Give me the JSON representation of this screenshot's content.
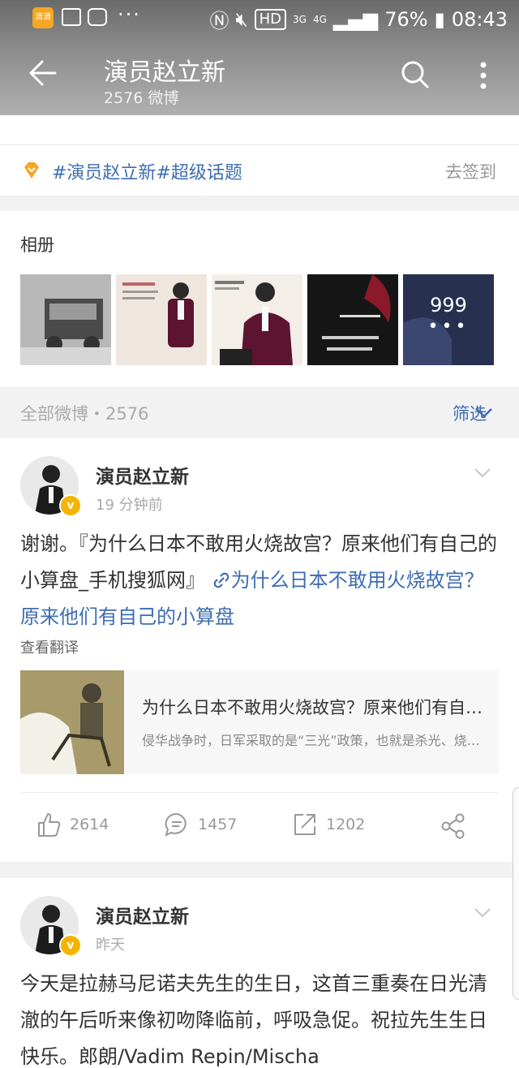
{
  "status_bar": {
    "battery": "76%",
    "time": "08:43",
    "network_a": "3G",
    "network_b": "4G",
    "hd": "HD",
    "app_badge": "滴滴"
  },
  "header": {
    "title": "演员赵立新",
    "subtitle": "2576 微博"
  },
  "topic": {
    "text": "#演员赵立新#超级话题",
    "action": "去签到"
  },
  "album": {
    "title": "相册",
    "more_count": "999"
  },
  "feed_bar": {
    "all": "全部微博・2576",
    "filter": "筛选"
  },
  "posts": [
    {
      "author": "演员赵立新",
      "time": "19 分钟前",
      "text": "谢谢。『为什么日本不敢用火烧故宫？原来他们有自己的小算盘_手机搜狐网』",
      "link": "为什么日本不敢用火烧故宫？原来他们有自己的小算盘",
      "translate": "查看翻译",
      "card": {
        "title": "为什么日本不敢用火烧故宫？原来他们有自己的小算盘",
        "desc": "侵华战争时，日军采取的是“三光”政策，也就是杀光、烧光、抢光"
      },
      "likes": "2614",
      "comments": "1457",
      "reposts": "1202"
    },
    {
      "author": "演员赵立新",
      "time": "昨天",
      "text": "今天是拉赫马尼诺夫先生的生日，这首三重奏在日光清澈的午后听来像初吻降临前，呼吸急促。祝拉先生生日快乐。郎朗/Vadim Repin/Mischa"
    }
  ],
  "colors": {
    "link": "#3d6db2",
    "badge": "#f5b400"
  }
}
